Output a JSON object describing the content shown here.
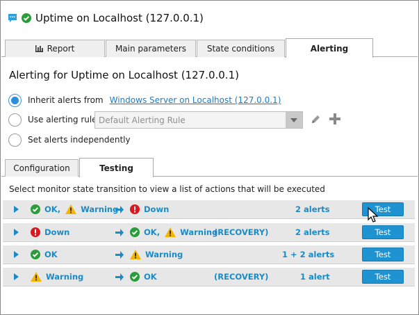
{
  "header": {
    "title": "Uptime on Localhost (127.0.0.1)"
  },
  "tabs": [
    {
      "label": "Report",
      "active": false
    },
    {
      "label": "Main parameters",
      "active": false
    },
    {
      "label": "State conditions",
      "active": false
    },
    {
      "label": "Alerting",
      "active": true
    }
  ],
  "alerting": {
    "title": "Alerting for Uptime on Localhost (127.0.0.1)",
    "inherit_label": "Inherit alerts from",
    "inherit_link": "Windows Server on Localhost (127.0.0.1)",
    "rule_label": "Use alerting rule",
    "rule_value": "Default Alerting Rule",
    "independent_label": "Set alerts independently"
  },
  "subtabs": [
    {
      "label": "Configuration",
      "active": false
    },
    {
      "label": "Testing",
      "active": true
    }
  ],
  "instructions": "Select monitor state transition to view a list of actions that will be executed",
  "rows": [
    {
      "from_1": "OK,",
      "from_2": "Warning",
      "to_1": "Down",
      "to_2": "",
      "recovery": "",
      "alerts": "2 alerts",
      "button": "Test"
    },
    {
      "from_1": "Down",
      "from_2": "",
      "to_1": "OK,",
      "to_2": "Warning",
      "recovery": "(RECOVERY)",
      "alerts": "2 alerts",
      "button": "Test"
    },
    {
      "from_1": "OK",
      "from_2": "",
      "to_1": "Warning",
      "to_2": "",
      "recovery": "",
      "alerts": "1 + 2 alerts",
      "button": "Test"
    },
    {
      "from_1": "Warning",
      "from_2": "",
      "to_1": "OK",
      "to_2": "",
      "recovery": "(RECOVERY)",
      "alerts": "1 alert",
      "button": "Test"
    }
  ],
  "colors": {
    "accent": "#1a8bc6",
    "ok": "#2a9d3a",
    "warning": "#f5b400",
    "down": "#d71920",
    "button": "#1f93d1"
  }
}
